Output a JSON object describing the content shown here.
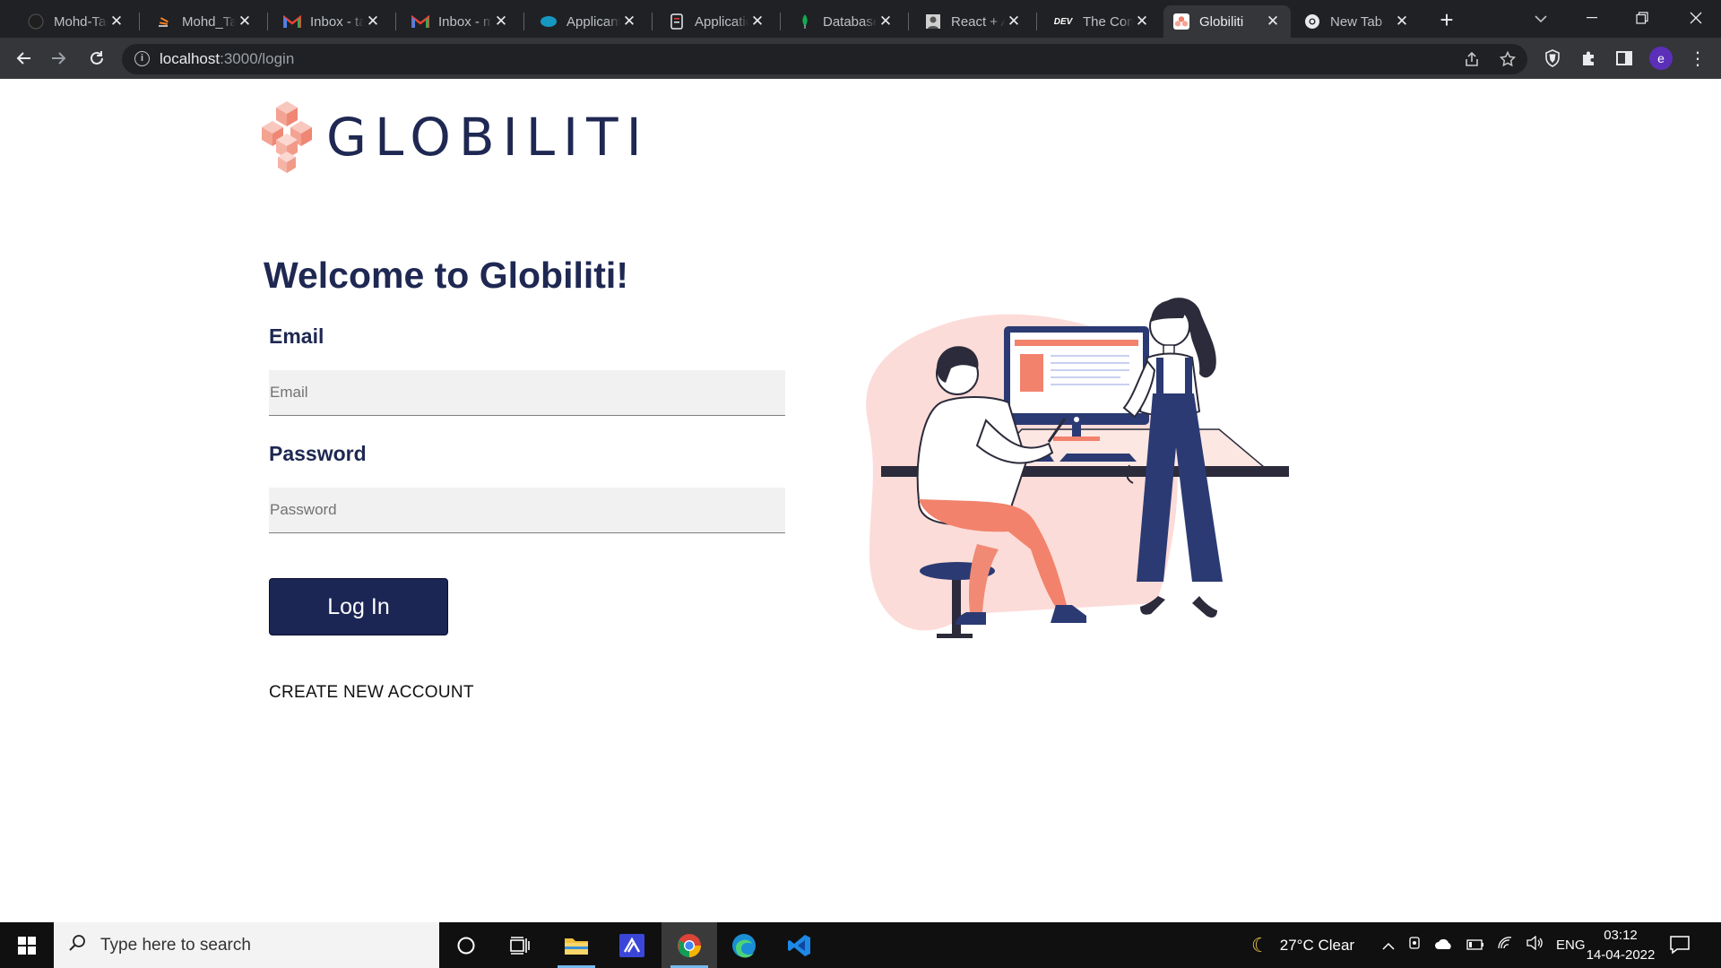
{
  "browser": {
    "tabs": [
      {
        "title": "Mohd-Taqi",
        "icon": "github-icon",
        "active": false
      },
      {
        "title": "Mohd_Taqi",
        "icon": "stackoverflow-icon",
        "active": false
      },
      {
        "title": "Inbox - taqi",
        "icon": "gmail-icon",
        "active": false
      },
      {
        "title": "Inbox - mohd",
        "icon": "gmail-icon",
        "active": false
      },
      {
        "title": "Applicant",
        "icon": "salesforce-icon",
        "active": false
      },
      {
        "title": "Application",
        "icon": "document-icon",
        "active": false
      },
      {
        "title": "Database",
        "icon": "mongodb-icon",
        "active": false
      },
      {
        "title": "React + Auth",
        "icon": "avatar-icon",
        "active": false
      },
      {
        "title": "The Community",
        "icon": "dev-icon",
        "active": false
      },
      {
        "title": "Globiliti",
        "icon": "globiliti-icon",
        "active": true
      },
      {
        "title": "New Tab",
        "icon": "chrome-icon",
        "active": false
      }
    ],
    "dev_badge": "DEV",
    "url_host": "localhost",
    "url_path": ":3000/login",
    "profile_initial": "e"
  },
  "page": {
    "brand": "GLOBILITI",
    "welcome": "Welcome to Globiliti!",
    "email_label": "Email",
    "email_placeholder": "Email",
    "email_value": "",
    "password_label": "Password",
    "password_placeholder": "Password",
    "password_value": "",
    "login_button": "Log In",
    "create_account": "CREATE NEW ACCOUNT"
  },
  "taskbar": {
    "search_placeholder": "Type here to search",
    "weather": "27°C  Clear",
    "language": "ENG",
    "time": "03:12",
    "date": "14-04-2022"
  },
  "colors": {
    "brand_navy": "#1c2655",
    "brand_coral": "#f2826c",
    "illustration_pink": "#fcdcd8"
  }
}
